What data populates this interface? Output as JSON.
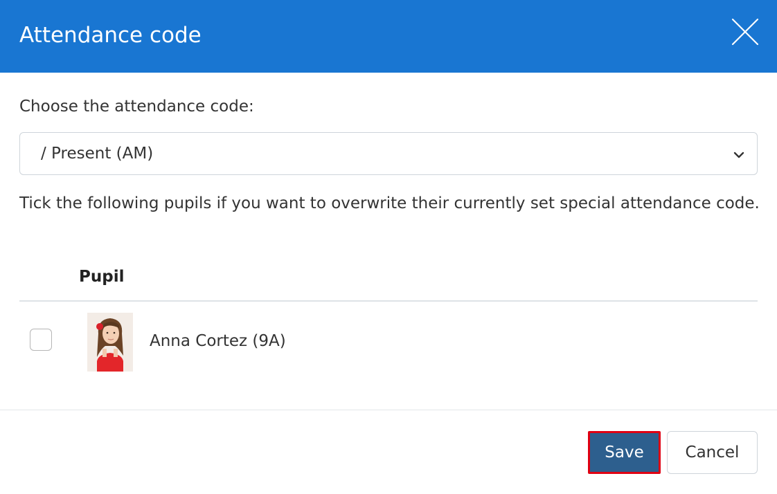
{
  "dialog": {
    "title": "Attendance code",
    "close_icon": "close-icon",
    "header_color": "#1976d2"
  },
  "attendance": {
    "prompt": "Choose the attendance code:",
    "selected_code": "/ Present (AM)",
    "dropdown_icon": "chevron-down-icon"
  },
  "instructions": "Tick the following pupils if you want to overwrite their currently set special attendance code.",
  "pupils_table": {
    "columns": [
      "Pupil"
    ],
    "rows": [
      {
        "name": "Anna Cortez (9A)",
        "checked": false,
        "avatar_icon": "pupil-photo"
      }
    ]
  },
  "footer": {
    "save_label": "Save",
    "cancel_label": "Cancel",
    "save_color": "#2d5f8e",
    "highlight_color": "#e00012"
  }
}
